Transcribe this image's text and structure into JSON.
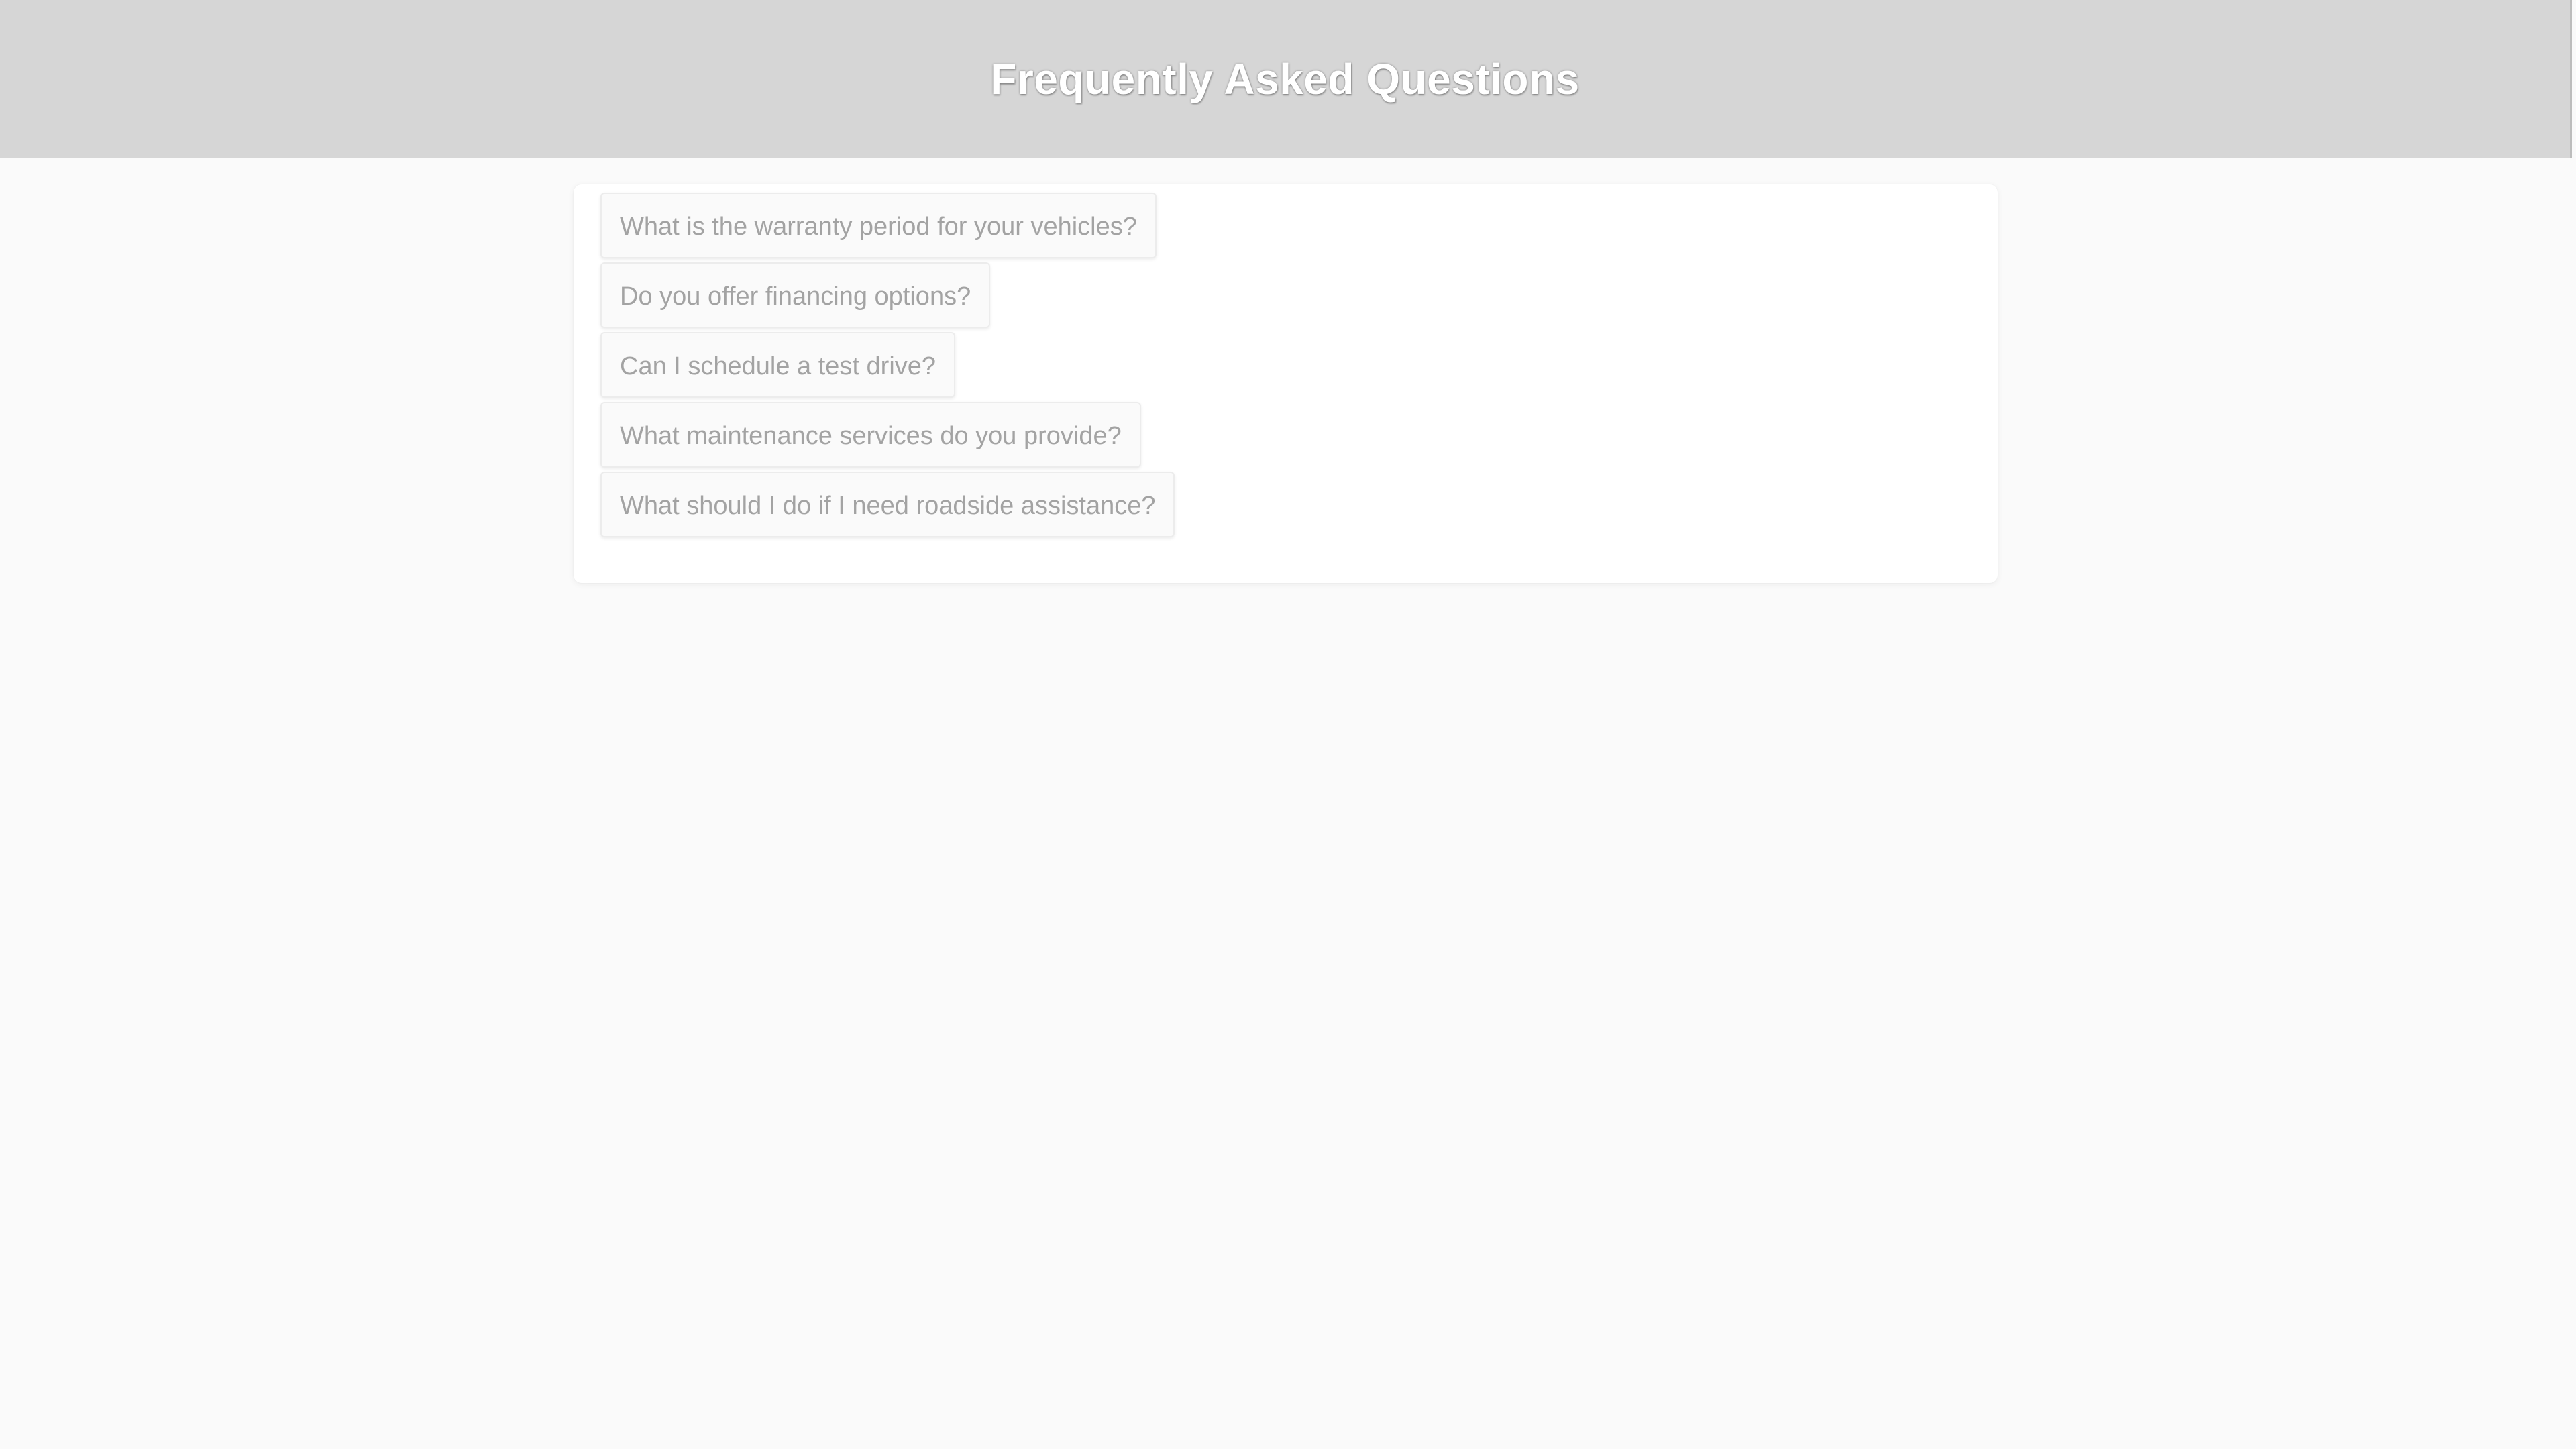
{
  "header": {
    "title": "Frequently Asked Questions"
  },
  "faq": {
    "questions": [
      "What is the warranty period for your vehicles?",
      "Do you offer financing options?",
      "Can I schedule a test drive?",
      "What maintenance services do you provide?",
      "What should I do if I need roadside assistance?"
    ]
  },
  "colors": {
    "header_background": "#d6d6d6",
    "header_text": "#ffffff",
    "page_background": "#fafafa",
    "card_background": "#ffffff",
    "question_text": "#a3a3a3"
  }
}
